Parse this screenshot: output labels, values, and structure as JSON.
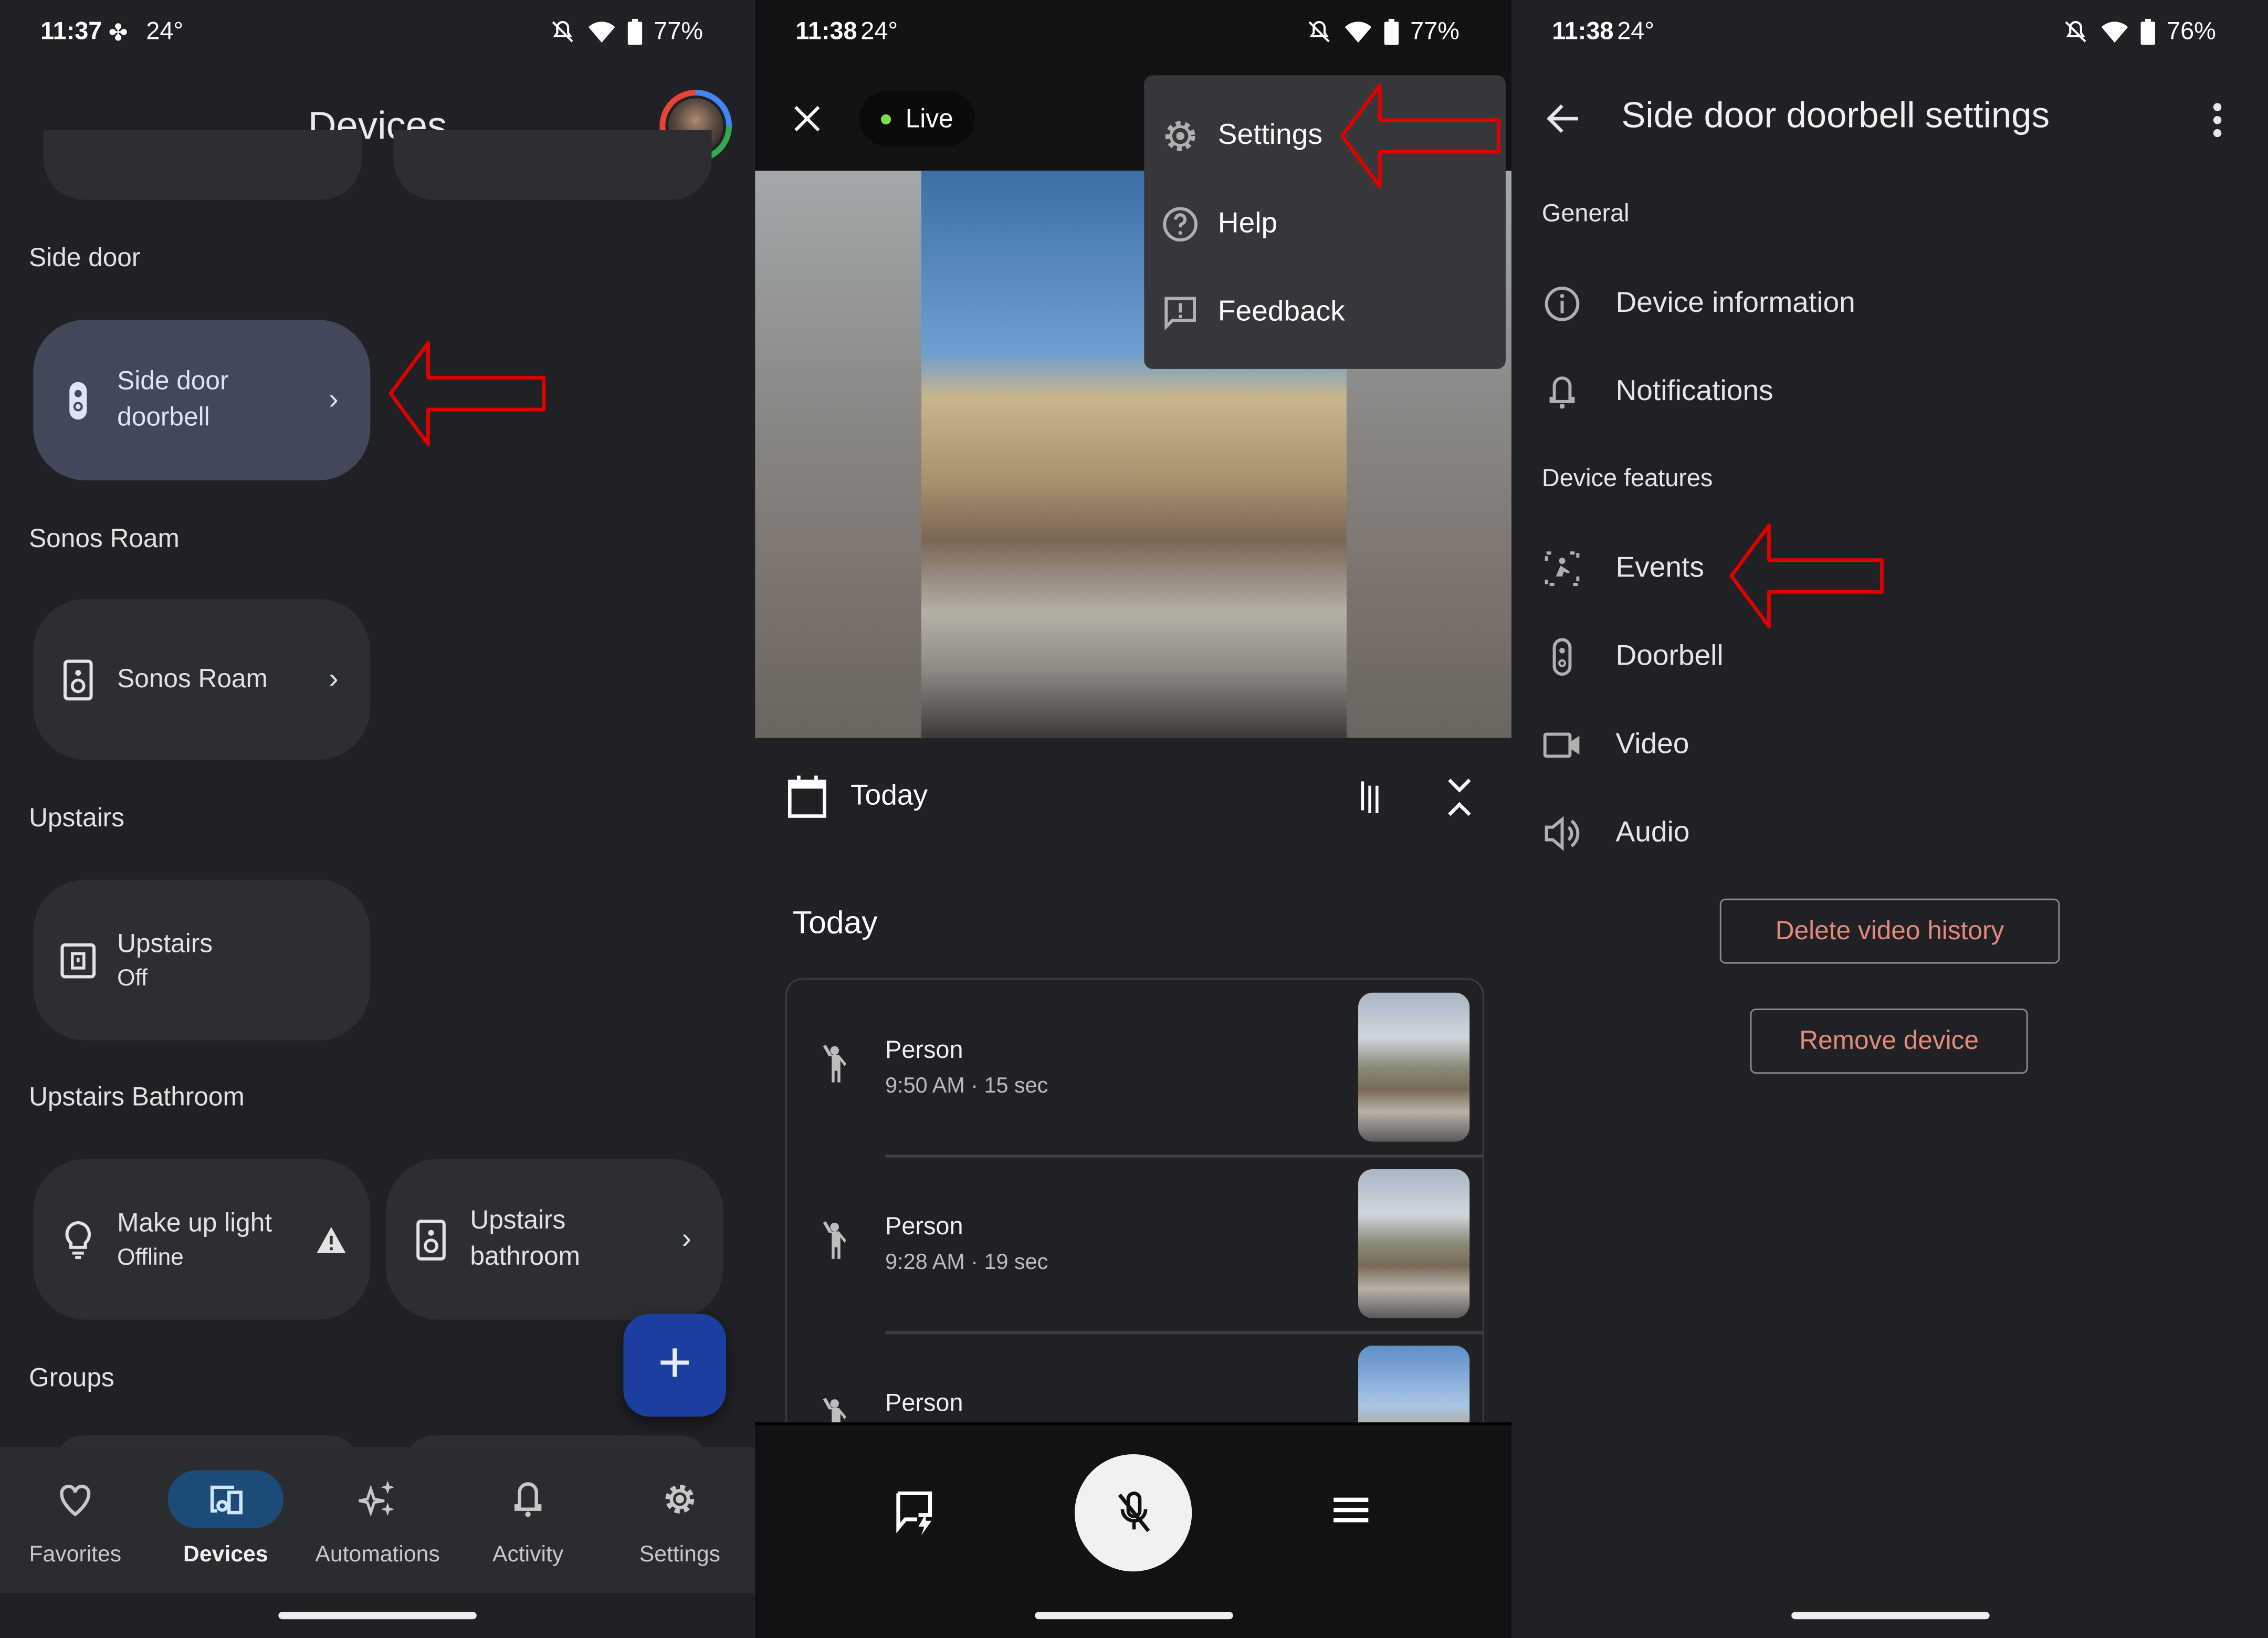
{
  "panels": {
    "devices": {
      "status": {
        "time": "11:37",
        "temp": "24°",
        "battery": "77%",
        "notif_icon": "slack-icon"
      },
      "title": "Devices",
      "sections": [
        {
          "label": "Side door",
          "cards": [
            {
              "name_line1": "Side door",
              "name_line2": "doorbell",
              "icon": "doorbell-icon",
              "selected": true,
              "chevron": true
            }
          ]
        },
        {
          "label": "Sonos Roam",
          "cards": [
            {
              "name_line1": "Sonos Roam",
              "icon": "speaker-icon",
              "chevron": true
            }
          ]
        },
        {
          "label": "Upstairs",
          "cards": [
            {
              "name_line1": "Upstairs",
              "status": "Off",
              "icon": "switch-icon"
            }
          ]
        },
        {
          "label": "Upstairs Bathroom",
          "cards": [
            {
              "name_line1": "Make up light",
              "status": "Offline",
              "icon": "lightbulb-icon",
              "warning": true
            },
            {
              "name_line1": "Upstairs",
              "name_line2": "bathroom",
              "icon": "speaker-icon",
              "chevron": true
            }
          ]
        },
        {
          "label": "Groups"
        }
      ],
      "fab_label": "+",
      "nav": [
        {
          "label": "Favorites",
          "icon": "heart-icon"
        },
        {
          "label": "Devices",
          "icon": "devices-icon",
          "active": true
        },
        {
          "label": "Automations",
          "icon": "sparkle-icon"
        },
        {
          "label": "Activity",
          "icon": "bell-icon"
        },
        {
          "label": "Settings",
          "icon": "gear-icon"
        }
      ],
      "accent": "#1d4b78",
      "fab_color": "#1a3fa0"
    },
    "camera": {
      "status": {
        "time": "11:38",
        "temp": "24°",
        "battery": "77%"
      },
      "live_label": "Live",
      "live_color": "#7ddc4b",
      "menu": [
        {
          "label": "Settings",
          "icon": "gear-icon"
        },
        {
          "label": "Help",
          "icon": "help-icon"
        },
        {
          "label": "Feedback",
          "icon": "feedback-icon"
        }
      ],
      "date_label": "Today",
      "section_heading": "Today",
      "events": [
        {
          "title": "Person",
          "subtitle": "9:50 AM · 15 sec"
        },
        {
          "title": "Person",
          "subtitle": "9:28 AM · 19 sec"
        },
        {
          "title": "Person",
          "subtitle": ""
        }
      ]
    },
    "settings": {
      "status": {
        "time": "11:38",
        "temp": "24°",
        "battery": "76%"
      },
      "title": "Side door doorbell settings",
      "general_label": "General",
      "general_items": [
        {
          "label": "Device information",
          "icon": "info-icon"
        },
        {
          "label": "Notifications",
          "icon": "bell-icon"
        }
      ],
      "features_label": "Device features",
      "feature_items": [
        {
          "label": "Events",
          "icon": "events-icon"
        },
        {
          "label": "Doorbell",
          "icon": "doorbell-icon"
        },
        {
          "label": "Video",
          "icon": "video-icon"
        },
        {
          "label": "Audio",
          "icon": "speaker-volume-icon"
        }
      ],
      "delete_history_label": "Delete video history",
      "remove_device_label": "Remove device",
      "danger_color": "#e5897b"
    }
  },
  "annotation_color": "#e00000"
}
